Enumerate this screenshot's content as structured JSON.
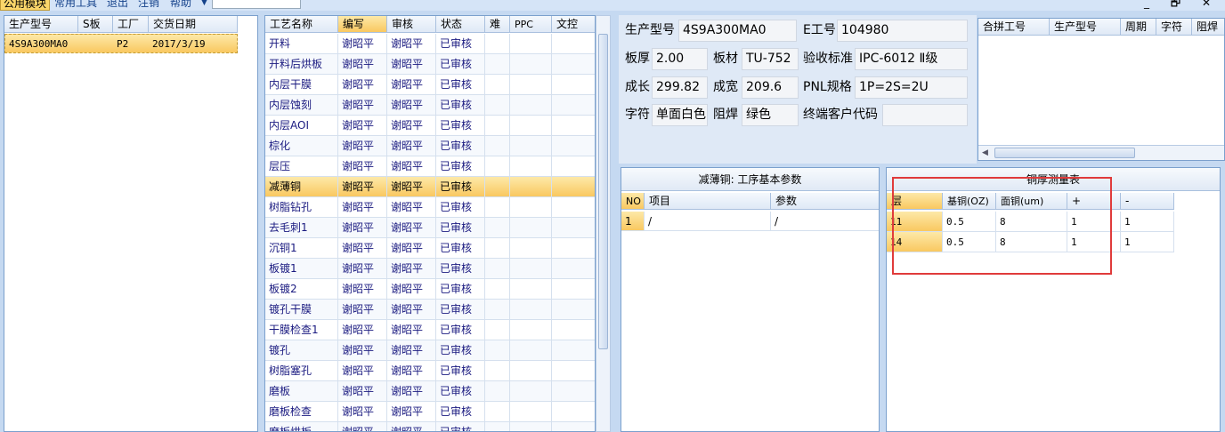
{
  "menu": {
    "items": [
      "公用模块",
      "常用工具",
      "退出",
      "注销",
      "帮助"
    ],
    "active": "公用模块",
    "window_controls": "_ 🗗 ✕"
  },
  "orders": {
    "columns": [
      "生产型号",
      "S板",
      "工厂",
      "交货日期"
    ],
    "rows": [
      {
        "model": "4S9A300MA0",
        "s": "",
        "factory": "P2",
        "date": "2017/3/19"
      }
    ]
  },
  "process": {
    "columns": [
      "工艺名称",
      "编写",
      "审核",
      "状态",
      "难",
      "PPC",
      "文控"
    ],
    "selected_index": 7,
    "rows": [
      {
        "name": "开料",
        "writer": "谢昭平",
        "reviewer": "谢昭平",
        "status": "已审核"
      },
      {
        "name": "开料后烘板",
        "writer": "谢昭平",
        "reviewer": "谢昭平",
        "status": "已审核"
      },
      {
        "name": "内层干膜",
        "writer": "谢昭平",
        "reviewer": "谢昭平",
        "status": "已审核"
      },
      {
        "name": "内层蚀刻",
        "writer": "谢昭平",
        "reviewer": "谢昭平",
        "status": "已审核"
      },
      {
        "name": "内层AOI",
        "writer": "谢昭平",
        "reviewer": "谢昭平",
        "status": "已审核"
      },
      {
        "name": "棕化",
        "writer": "谢昭平",
        "reviewer": "谢昭平",
        "status": "已审核"
      },
      {
        "name": "层压",
        "writer": "谢昭平",
        "reviewer": "谢昭平",
        "status": "已审核"
      },
      {
        "name": "减薄铜",
        "writer": "谢昭平",
        "reviewer": "谢昭平",
        "status": "已审核"
      },
      {
        "name": "树脂钻孔",
        "writer": "谢昭平",
        "reviewer": "谢昭平",
        "status": "已审核"
      },
      {
        "name": "去毛刺1",
        "writer": "谢昭平",
        "reviewer": "谢昭平",
        "status": "已审核"
      },
      {
        "name": "沉铜1",
        "writer": "谢昭平",
        "reviewer": "谢昭平",
        "status": "已审核"
      },
      {
        "name": "板镀1",
        "writer": "谢昭平",
        "reviewer": "谢昭平",
        "status": "已审核"
      },
      {
        "name": "板镀2",
        "writer": "谢昭平",
        "reviewer": "谢昭平",
        "status": "已审核"
      },
      {
        "name": "镀孔干膜",
        "writer": "谢昭平",
        "reviewer": "谢昭平",
        "status": "已审核"
      },
      {
        "name": "干膜检查1",
        "writer": "谢昭平",
        "reviewer": "谢昭平",
        "status": "已审核"
      },
      {
        "name": "镀孔",
        "writer": "谢昭平",
        "reviewer": "谢昭平",
        "status": "已审核"
      },
      {
        "name": "树脂塞孔",
        "writer": "谢昭平",
        "reviewer": "谢昭平",
        "status": "已审核"
      },
      {
        "name": "磨板",
        "writer": "谢昭平",
        "reviewer": "谢昭平",
        "status": "已审核"
      },
      {
        "name": "磨板检查",
        "writer": "谢昭平",
        "reviewer": "谢昭平",
        "status": "已审核"
      },
      {
        "name": "磨板烘板",
        "writer": "谢昭平",
        "reviewer": "谢昭平",
        "status": "已审核"
      }
    ]
  },
  "info": {
    "model_label": "生产型号",
    "model": "4S9A300MA0",
    "eno_label": "E工号",
    "eno": "104980",
    "thick_label": "板厚",
    "thick": "2.00",
    "material_label": "板材",
    "material": "TU-752",
    "std_label": "验收标准",
    "std": "IPC-6012 Ⅱ级",
    "length_label": "成长",
    "length": "299.82",
    "width_label": "成宽",
    "width": "209.6",
    "pnl_label": "PNL规格",
    "pnl": "1P=2S=2U",
    "char_label": "字符",
    "char": "单面白色",
    "mask_label": "阻焊",
    "mask": "绿色",
    "cust_label": "终端客户代码",
    "cust": ""
  },
  "merge": {
    "columns": [
      "合拼工号",
      "生产型号",
      "周期",
      "字符",
      "阻焊"
    ]
  },
  "params": {
    "title": "减薄铜: 工序基本参数",
    "columns": [
      "NO",
      "项目",
      "参数"
    ],
    "rows": [
      {
        "no": "1",
        "item": "/",
        "value": "/"
      }
    ]
  },
  "copper": {
    "title": "铜厚测量表",
    "columns": [
      "层",
      "基铜(OZ)",
      "面铜(um)",
      "+",
      "-"
    ],
    "rows": [
      {
        "layer": "11",
        "base": "0.5",
        "surface": "8",
        "plus": "1",
        "minus": "1"
      },
      {
        "layer": "14",
        "base": "0.5",
        "surface": "8",
        "plus": "1",
        "minus": "1"
      }
    ]
  }
}
